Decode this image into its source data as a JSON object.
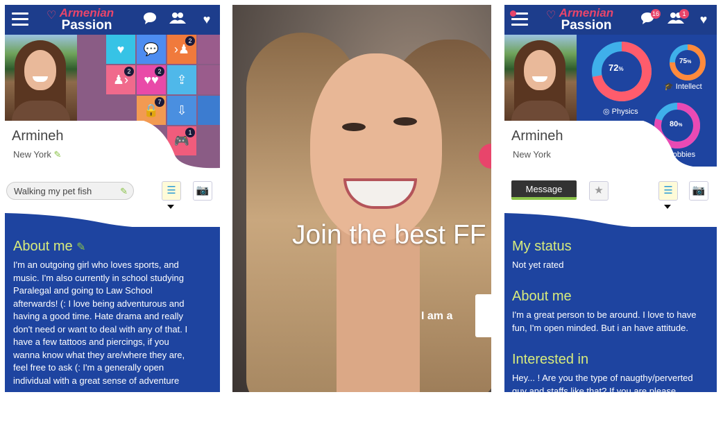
{
  "app": {
    "logo_top": "Armenian",
    "logo_bottom": "Passion"
  },
  "panel1": {
    "profile_name": "Armineh",
    "location": "New York",
    "status_text": "Walking my pet fish",
    "grid_badges": [
      "2",
      "2",
      "2",
      "7",
      "1"
    ],
    "about_title": "About me",
    "about_lines": [
      "I'm an outgoing girl who loves sports, and",
      "music. I'm also currently in school studying",
      "Paralegal and going to Law School",
      "afterwards! (: I love being adventurous and",
      "having a good time. Hate drama and really",
      "don't need or want to deal with any of that. I",
      "have a few tattoos and piercings, if you",
      "wanna know what they are/where they are,",
      "feel free to ask (: I'm a generally open",
      "individual with a great sense of adventure"
    ]
  },
  "panel2": {
    "headline": "Join the best FF",
    "iam": "I am a"
  },
  "panel3": {
    "profile_name": "Armineh",
    "location": "New York",
    "chat_badge": "16",
    "friends_badge": "1",
    "message_button": "Message",
    "stats": [
      {
        "label": "Physics",
        "value": "72",
        "unit": "%",
        "color": "#ff5c6c",
        "percent": 72
      },
      {
        "label": "Intellect",
        "value": "75",
        "unit": "%",
        "color": "#ff8a3c",
        "percent": 75
      },
      {
        "label": "Hobbies",
        "value": "80",
        "unit": "%",
        "color": "#e84ab4",
        "percent": 80
      }
    ],
    "my_status_title": "My status",
    "my_status_text": "Not yet rated",
    "about_title": "About me",
    "about_lines": [
      "I'm a great person to be around. I love to have",
      "fun, I'm open minded. But i an have attitude."
    ],
    "interested_title": "Interested in",
    "interested_lines": [
      "Hey... ! Are you the type of naugthy/perverted",
      "guy and staffs like that? If you are please"
    ]
  }
}
